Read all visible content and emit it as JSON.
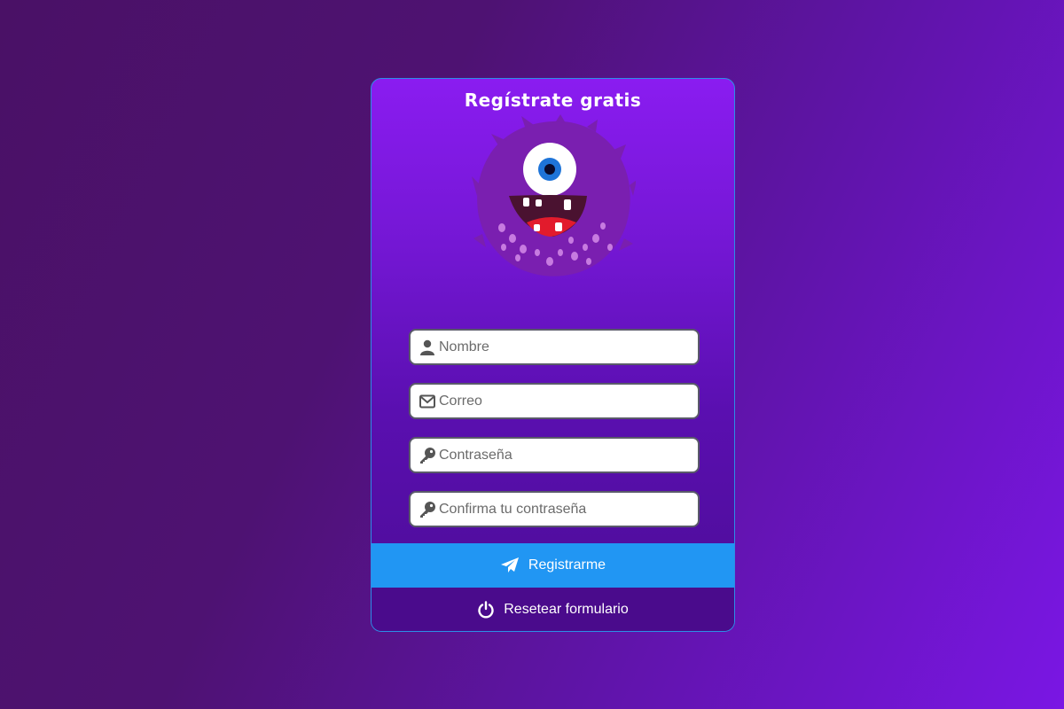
{
  "form": {
    "title": "Regístrate gratis",
    "fields": [
      {
        "placeholder": "Nombre",
        "icon": "user-icon"
      },
      {
        "placeholder": "Correo",
        "icon": "envelope-icon"
      },
      {
        "placeholder": "Contraseña",
        "icon": "key-icon"
      },
      {
        "placeholder": "Confirma tu contraseña",
        "icon": "key-icon"
      }
    ],
    "register_label": "Registrarme",
    "register_icon": "paper-plane-icon",
    "reset_label": "Resetear formulario",
    "reset_icon": "power-icon"
  },
  "colors": {
    "accent": "#2196f3",
    "card_top": "#8a1cf0",
    "card_bottom": "#4c0c96"
  }
}
